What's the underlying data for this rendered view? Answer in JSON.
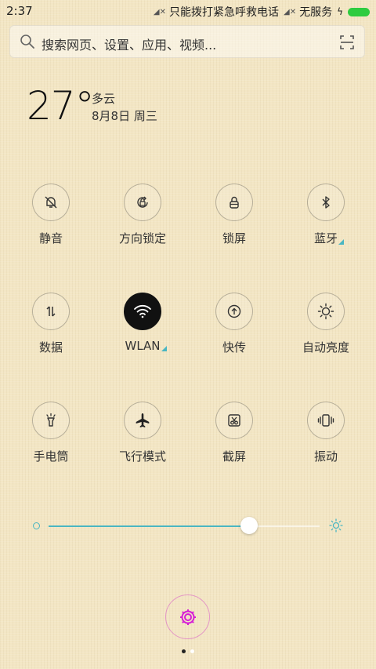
{
  "status": {
    "time": "2:37",
    "sim1": "只能拨打紧急呼救电话",
    "sim2": "无服务"
  },
  "search": {
    "placeholder": "搜索网页、设置、应用、视频..."
  },
  "weather": {
    "temp": "27°",
    "condition": "多云",
    "date": "8月8日 周三"
  },
  "toggles": [
    {
      "label": "静音",
      "icon": "bell-mute-icon",
      "on": false
    },
    {
      "label": "方向锁定",
      "icon": "rotation-lock-icon",
      "on": false
    },
    {
      "label": "锁屏",
      "icon": "lock-icon",
      "on": false
    },
    {
      "label": "蓝牙",
      "icon": "bluetooth-icon",
      "on": false
    },
    {
      "label": "数据",
      "icon": "data-arrows-icon",
      "on": false
    },
    {
      "label": "WLAN",
      "icon": "wifi-icon",
      "on": true
    },
    {
      "label": "快传",
      "icon": "quick-send-icon",
      "on": false
    },
    {
      "label": "自动亮度",
      "icon": "auto-brightness-icon",
      "on": false
    },
    {
      "label": "手电筒",
      "icon": "flashlight-icon",
      "on": false
    },
    {
      "label": "飞行模式",
      "icon": "airplane-icon",
      "on": false
    },
    {
      "label": "截屏",
      "icon": "screenshot-icon",
      "on": false
    },
    {
      "label": "振动",
      "icon": "vibrate-icon",
      "on": false
    }
  ],
  "brightness": {
    "level": 0.74
  },
  "colors": {
    "accent": "#4ab6c2",
    "settings": "#d61fd6"
  },
  "pager": {
    "pages": 2,
    "current": 1
  }
}
